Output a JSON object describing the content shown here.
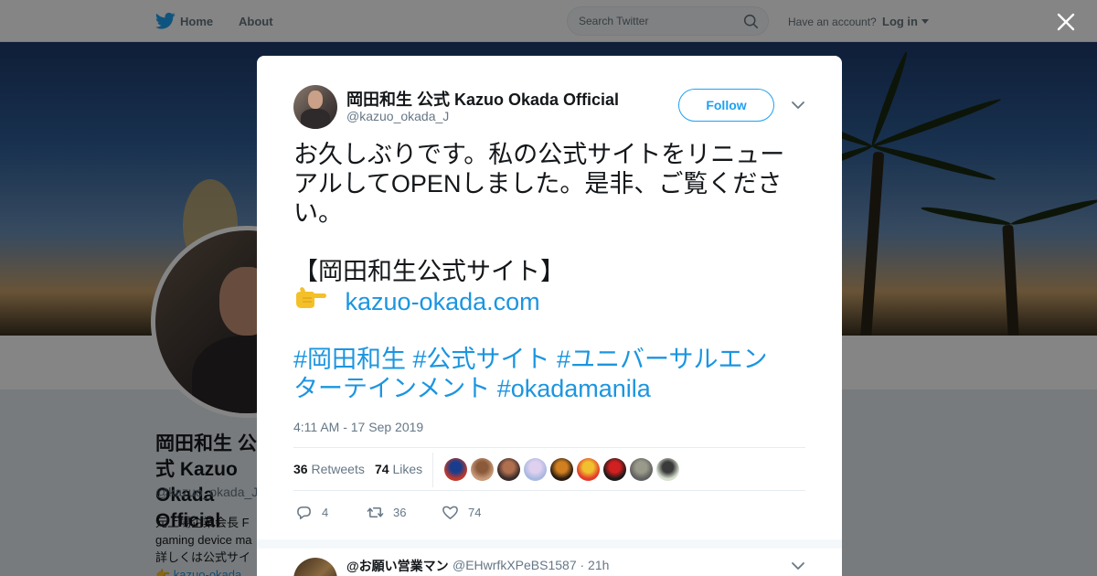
{
  "topbar": {
    "home_label": "Home",
    "about_label": "About",
    "search_placeholder": "Search Twitter",
    "account_prompt": "Have an account?",
    "login_label": "Log in"
  },
  "profile": {
    "name": "岡田和生 公式 Kazuo Okada Official",
    "handle": "@kazuo_okada_J",
    "bio_lines": [
      "元上場企業会長 F",
      "gaming device ma",
      "詳しくは公式サイ",
      "👉 kazuo-okada"
    ]
  },
  "tweet": {
    "author_name": "岡田和生 公式 Kazuo Okada Official",
    "author_handle": "@kazuo_okada_J",
    "follow_label": "Follow",
    "text_lines": [
      "お久しぶりです。私の公式サイトをリニュー",
      "アルしてOPENしました。是非、ご覧くださ",
      "い。"
    ],
    "site_heading": "【岡田和生公式サイト】",
    "link_text": "kazuo-okada.com",
    "hashtags_line1": "#岡田和生 #公式サイト #ユニバーサルエン",
    "hashtags_line2": "ターテインメント #okadamanila",
    "timestamp": "4:11 AM - 17 Sep 2019",
    "retweets_count": "36",
    "retweets_label": "Retweets",
    "likes_count": "74",
    "likes_label": "Likes",
    "replies_action_count": "4",
    "retweets_action_count": "36",
    "likes_action_count": "74"
  },
  "likers": [
    {
      "color": "#c0392b",
      "accent": "#1a3c8c"
    },
    {
      "color": "#c79a7a",
      "accent": "#8a5a3a"
    },
    {
      "color": "#3a2a2a",
      "accent": "#b07050"
    },
    {
      "color": "#a8b8e0",
      "accent": "#e0d0f0"
    },
    {
      "color": "#2a1a10",
      "accent": "#d08020"
    },
    {
      "color": "#e23a2a",
      "accent": "#f0c030"
    },
    {
      "color": "#1a1a1a",
      "accent": "#d02020"
    },
    {
      "color": "#606060",
      "accent": "#9a9a8a"
    },
    {
      "color": "#d8e0d0",
      "accent": "#3a3a3a"
    }
  ],
  "reply": {
    "name": "@お願い営業マン",
    "handle_time": "@EHwrfkXPeBS1587 · 21h"
  },
  "colors": {
    "accent": "#1da1f2",
    "link": "#1b95e0",
    "muted": "#657786"
  }
}
